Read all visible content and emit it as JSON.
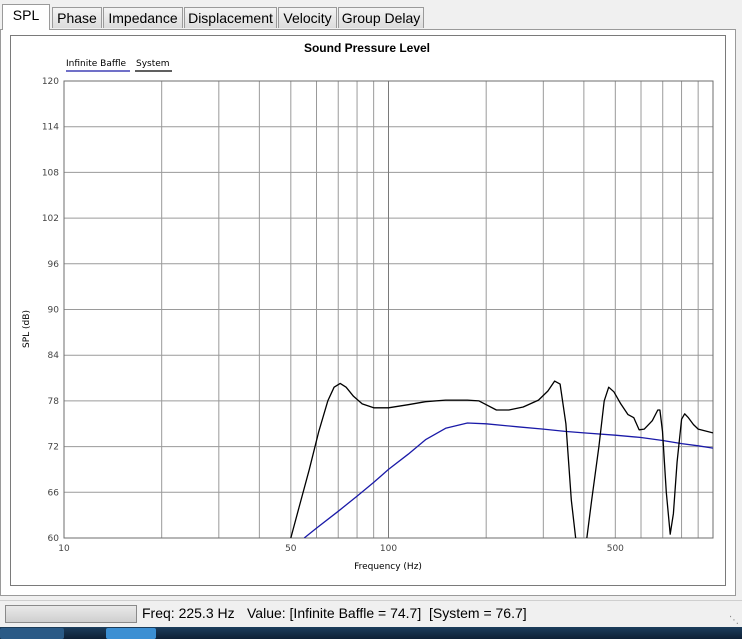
{
  "tabs": [
    {
      "label": "SPL",
      "active": true
    },
    {
      "label": "Phase",
      "active": false
    },
    {
      "label": "Impedance",
      "active": false
    },
    {
      "label": "Displacement",
      "active": false
    },
    {
      "label": "Velocity",
      "active": false
    },
    {
      "label": "Group Delay",
      "active": false
    }
  ],
  "chart_data": {
    "type": "line",
    "title": "Sound Pressure Level",
    "xlabel": "Frequency (Hz)",
    "ylabel": "SPL (dB)",
    "x_scale": "log",
    "xlim": [
      10,
      1000
    ],
    "ylim": [
      60,
      120
    ],
    "x_tick_labels": [
      "10",
      "50",
      "100",
      "500"
    ],
    "x_tick_values": [
      10,
      50,
      100,
      500
    ],
    "y_ticks": [
      60,
      66,
      72,
      78,
      84,
      90,
      96,
      102,
      108,
      114,
      120
    ],
    "grid": true,
    "legend_position": "top-left",
    "series": [
      {
        "name": "Infinite Baffle",
        "color": "#1a1aa8",
        "points": [
          [
            55,
            60
          ],
          [
            60,
            61.3
          ],
          [
            70,
            63.5
          ],
          [
            80,
            65.5
          ],
          [
            90,
            67.3
          ],
          [
            100,
            69
          ],
          [
            115,
            71
          ],
          [
            130,
            72.9
          ],
          [
            150,
            74.4
          ],
          [
            175,
            75.1
          ],
          [
            200,
            75
          ],
          [
            250,
            74.6
          ],
          [
            300,
            74.3
          ],
          [
            350,
            74
          ],
          [
            400,
            73.8
          ],
          [
            500,
            73.5
          ],
          [
            600,
            73.2
          ],
          [
            700,
            72.8
          ],
          [
            800,
            72.4
          ],
          [
            900,
            72.1
          ],
          [
            1000,
            71.8
          ]
        ]
      },
      {
        "name": "System",
        "color": "#000000",
        "points": [
          [
            50,
            60
          ],
          [
            53,
            64
          ],
          [
            57,
            69
          ],
          [
            61,
            74
          ],
          [
            65,
            78
          ],
          [
            68,
            79.8
          ],
          [
            71,
            80.3
          ],
          [
            74,
            79.8
          ],
          [
            78,
            78.6
          ],
          [
            83,
            77.6
          ],
          [
            90,
            77.1
          ],
          [
            100,
            77.1
          ],
          [
            115,
            77.5
          ],
          [
            130,
            77.9
          ],
          [
            150,
            78.1
          ],
          [
            175,
            78.1
          ],
          [
            190,
            78
          ],
          [
            200,
            77.5
          ],
          [
            215,
            76.8
          ],
          [
            235,
            76.8
          ],
          [
            260,
            77.2
          ],
          [
            290,
            78.1
          ],
          [
            310,
            79.3
          ],
          [
            325,
            80.6
          ],
          [
            338,
            80.2
          ],
          [
            352,
            75
          ],
          [
            366,
            65
          ],
          [
            382,
            58
          ],
          [
            393,
            57
          ],
          [
            403,
            58
          ],
          [
            423,
            65
          ],
          [
            445,
            72
          ],
          [
            462,
            78
          ],
          [
            477,
            79.8
          ],
          [
            495,
            79.2
          ],
          [
            520,
            77.6
          ],
          [
            547,
            76.2
          ],
          [
            570,
            75.8
          ],
          [
            592,
            74.2
          ],
          [
            614,
            74.3
          ],
          [
            650,
            75.4
          ],
          [
            676,
            76.8
          ],
          [
            686,
            76.8
          ],
          [
            699,
            74
          ],
          [
            718,
            66
          ],
          [
            738,
            60.5
          ],
          [
            755,
            63.2
          ],
          [
            775,
            70
          ],
          [
            800,
            75.6
          ],
          [
            818,
            76.3
          ],
          [
            840,
            75.8
          ],
          [
            870,
            74.9
          ],
          [
            900,
            74.3
          ],
          [
            1000,
            73.8
          ]
        ]
      }
    ]
  },
  "status": {
    "freq_text": "Freq: 225.3 Hz",
    "value_text": "Value: [Infinite Baffle = 74.7]  [System = 76.7]"
  }
}
